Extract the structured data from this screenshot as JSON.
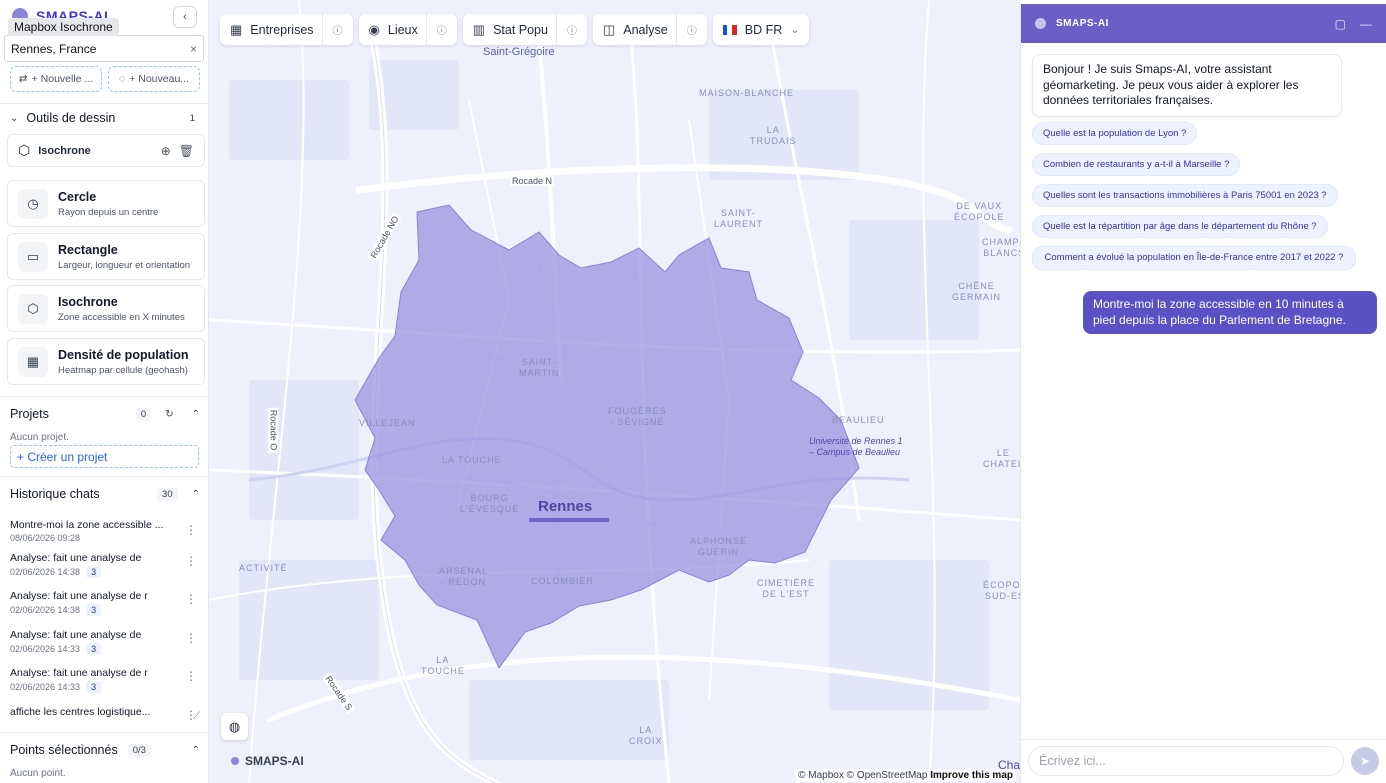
{
  "sidebar": {
    "brand": "SMAPS-AI",
    "tooltip": "Mapbox Isochrone",
    "collapse_icon": "‹",
    "search_value": "Rennes, France",
    "search_clear": "×",
    "new_buttons": [
      {
        "icon": "⇄",
        "label": "+ Nouvelle ..."
      },
      {
        "icon": "◌",
        "label": "+ Nouveau..."
      }
    ],
    "drawing_tools": {
      "title": "Outils de dessin",
      "count": "1",
      "active_item": "Isochrone",
      "tools": [
        {
          "title": "Cercle",
          "subtitle": "Rayon depuis un centre",
          "icon": "◷"
        },
        {
          "title": "Rectangle",
          "subtitle": "Largeur, longueur et orientation",
          "icon": "▭"
        },
        {
          "title": "Isochrone",
          "subtitle": "Zone accessible en X minutes",
          "icon": "⬡"
        },
        {
          "title": "Densité de population",
          "subtitle": "Heatmap par cellule (geohash)",
          "icon": "▦"
        }
      ]
    },
    "projects": {
      "title": "Projets",
      "count": "0",
      "empty": "Aucun projet.",
      "create": "+ Créer un projet"
    },
    "history": {
      "title": "Historique chats",
      "count": "30",
      "items": [
        {
          "title": "Montre-moi la zone accessible ...",
          "date": "08/06/2026 09:28",
          "badge": ""
        },
        {
          "title": "Analyse: fait une analyse de",
          "date": "02/06/2026 14:38",
          "badge": "3"
        },
        {
          "title": "Analyse: fait une analyse de r",
          "date": "02/06/2026 14:38",
          "badge": "3"
        },
        {
          "title": "Analyse: fait une analyse de",
          "date": "02/06/2026 14:33",
          "badge": "3"
        },
        {
          "title": "Analyse: fait une analyse de r",
          "date": "02/06/2026 14:33",
          "badge": "3"
        },
        {
          "title": "affiche les centres logistique...",
          "date": "",
          "badge": ""
        }
      ]
    },
    "selected_points": {
      "title": "Points sélectionnés",
      "count": "0/3",
      "empty": "Aucun point."
    }
  },
  "map": {
    "toolbar": [
      {
        "icon": "▦",
        "label": "Entreprises"
      },
      {
        "icon": "◉",
        "label": "Lieux"
      },
      {
        "icon": "▥",
        "label": "Stat Popu"
      },
      {
        "icon": "◫",
        "label": "Analyse"
      }
    ],
    "db_selector": "BD FR",
    "info_icon": "ⓘ",
    "city": "Rennes",
    "district_labels": [
      "SAINT-",
      "LAURENT",
      "SAINT-",
      "MARTIN",
      "FOUGÈRES",
      "- SÉVIGNÉ",
      "VILLEJEAN",
      "LA TOUCHE",
      "BOURG",
      "L'ÉVESQUE",
      "ALPHONSE",
      "GUÉRIN",
      "ARSENAL",
      "- REDON",
      "COLOMBIER",
      "CIMETIÈRE",
      "DE L'EST",
      "BEAULIEU",
      "ACTIVITÉ",
      "LE",
      "CHATEL",
      "LA",
      "TRUDAIS",
      "MAISON-BLANCHE",
      "CHAMPS",
      "BLANCS",
      "ÉCOPOLE",
      "DE VAUX",
      "LE",
      "ÉCOPOLE",
      "SUD-EST",
      "CHÊNE",
      "GERMAIN",
      "LA",
      "TOUCHE",
      "LA",
      "CROIX"
    ],
    "places": [
      "Saint-Grégoire"
    ],
    "roads": [
      "Rocade N",
      "Rocade NO",
      "Rocade O",
      "Rocade S"
    ],
    "campus": [
      "Université de Rennes 1",
      "– Campus de Beaulieu"
    ],
    "brand": "SMAPS-AI",
    "attribution": [
      "© Mapbox",
      "© OpenStreetMap",
      "Improve this map"
    ],
    "corner_text": "Cha",
    "polygon_color": "#9b94e0"
  },
  "chat": {
    "title": "SMAPS-AI",
    "greeting": "Bonjour ! Je suis Smaps-AI, votre assistant géomarketing. Je peux vous aider à explorer les données territoriales françaises.",
    "suggestions": [
      "Quelle est la population de Lyon ?",
      "Combien de restaurants y a-t-il à Marseille ?",
      "Quelles sont les transactions immobilières à Paris 75001 en 2023 ?",
      "Quelle est la répartition par âge dans le département du Rhône ?",
      "Comment a évolué la population en Île-de-France entre 2017 et 2022 ?"
    ],
    "user_message": "Montre-moi la zone accessible en 10 minutes à pied depuis la place du Parlement de Bretagne.",
    "input_placeholder": "Écrivez ici...",
    "send_icon": "➤",
    "accent": "#6b5fc7"
  }
}
